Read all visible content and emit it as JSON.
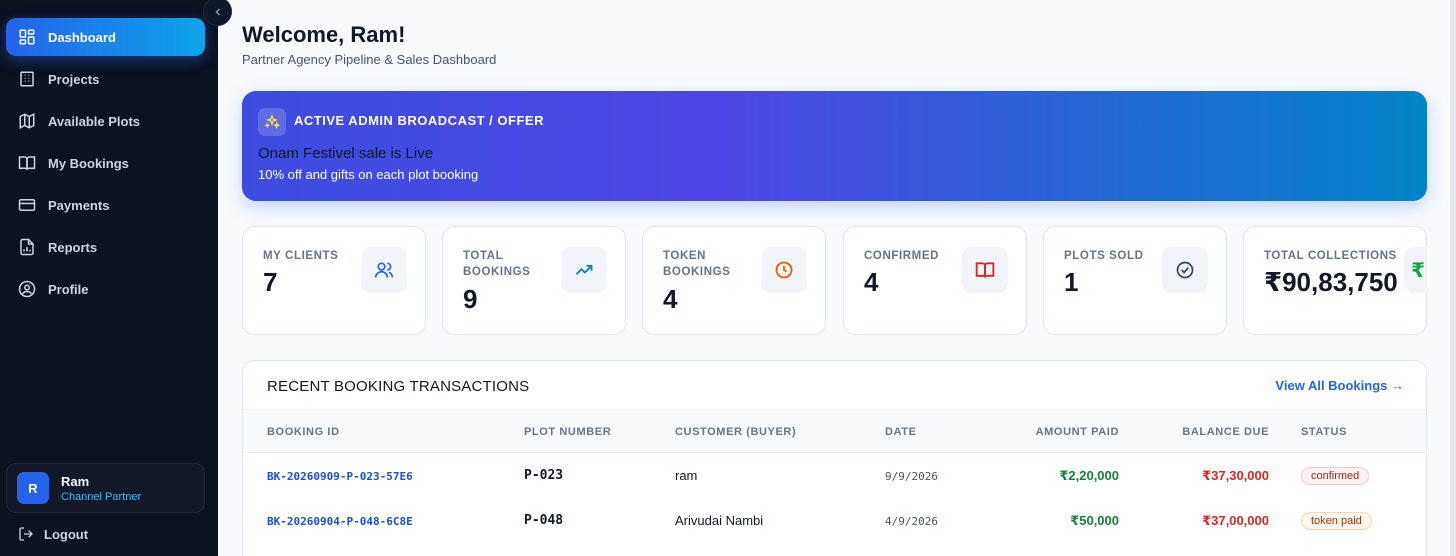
{
  "sidebar": {
    "items": [
      {
        "label": "Dashboard",
        "icon": "dashboard-icon",
        "active": true
      },
      {
        "label": "Projects",
        "icon": "building-icon"
      },
      {
        "label": "Available Plots",
        "icon": "map-icon"
      },
      {
        "label": "My Bookings",
        "icon": "book-icon"
      },
      {
        "label": "Payments",
        "icon": "card-icon"
      },
      {
        "label": "Reports",
        "icon": "report-icon"
      },
      {
        "label": "Profile",
        "icon": "profile-icon"
      }
    ],
    "user": {
      "initial": "R",
      "name": "Ram",
      "role": "Channel Partner"
    },
    "logout_label": "Logout"
  },
  "header": {
    "welcome": "Welcome, Ram!",
    "subtitle": "Partner Agency Pipeline & Sales Dashboard"
  },
  "broadcast": {
    "label": "ACTIVE ADMIN BROADCAST / OFFER",
    "title": "Onam Festivel sale is Live",
    "text": "10% off and gifts on each plot booking"
  },
  "stats": [
    {
      "label": "MY CLIENTS",
      "value": "7",
      "icon": "users-icon",
      "color": "#2563eb"
    },
    {
      "label": "TOTAL BOOKINGS",
      "value": "9",
      "icon": "trending-up-icon",
      "color": "#0284c7"
    },
    {
      "label": "TOKEN BOOKINGS",
      "value": "4",
      "icon": "clock-icon",
      "color": "#ea580c"
    },
    {
      "label": "CONFIRMED",
      "value": "4",
      "icon": "book-open-icon",
      "color": "#dc2626"
    },
    {
      "label": "PLOTS SOLD",
      "value": "1",
      "icon": "check-circle-icon",
      "color": "#334155"
    },
    {
      "label": "TOTAL COLLECTIONS",
      "value": "₹90,83,750",
      "icon": "rupee-icon",
      "icon_glyph": "₹",
      "color": "#16a34a"
    }
  ],
  "transactions": {
    "title": "RECENT BOOKING TRANSACTIONS",
    "view_all": "View All Bookings →",
    "columns": [
      "BOOKING ID",
      "PLOT NUMBER",
      "CUSTOMER (BUYER)",
      "DATE",
      "AMOUNT PAID",
      "BALANCE DUE",
      "STATUS"
    ],
    "rows": [
      {
        "booking_id": "BK-20260909-P-023-57E6",
        "plot": "P-023",
        "customer": "ram",
        "date": "9/9/2026",
        "amount_paid": "₹2,20,000",
        "balance_due": "₹37,30,000",
        "status": "confirmed"
      },
      {
        "booking_id": "BK-20260904-P-048-6C8E",
        "plot": "P-048",
        "customer": "Arivudai Nambi",
        "date": "4/9/2026",
        "amount_paid": "₹50,000",
        "balance_due": "₹37,00,000",
        "status": "token paid"
      }
    ]
  }
}
